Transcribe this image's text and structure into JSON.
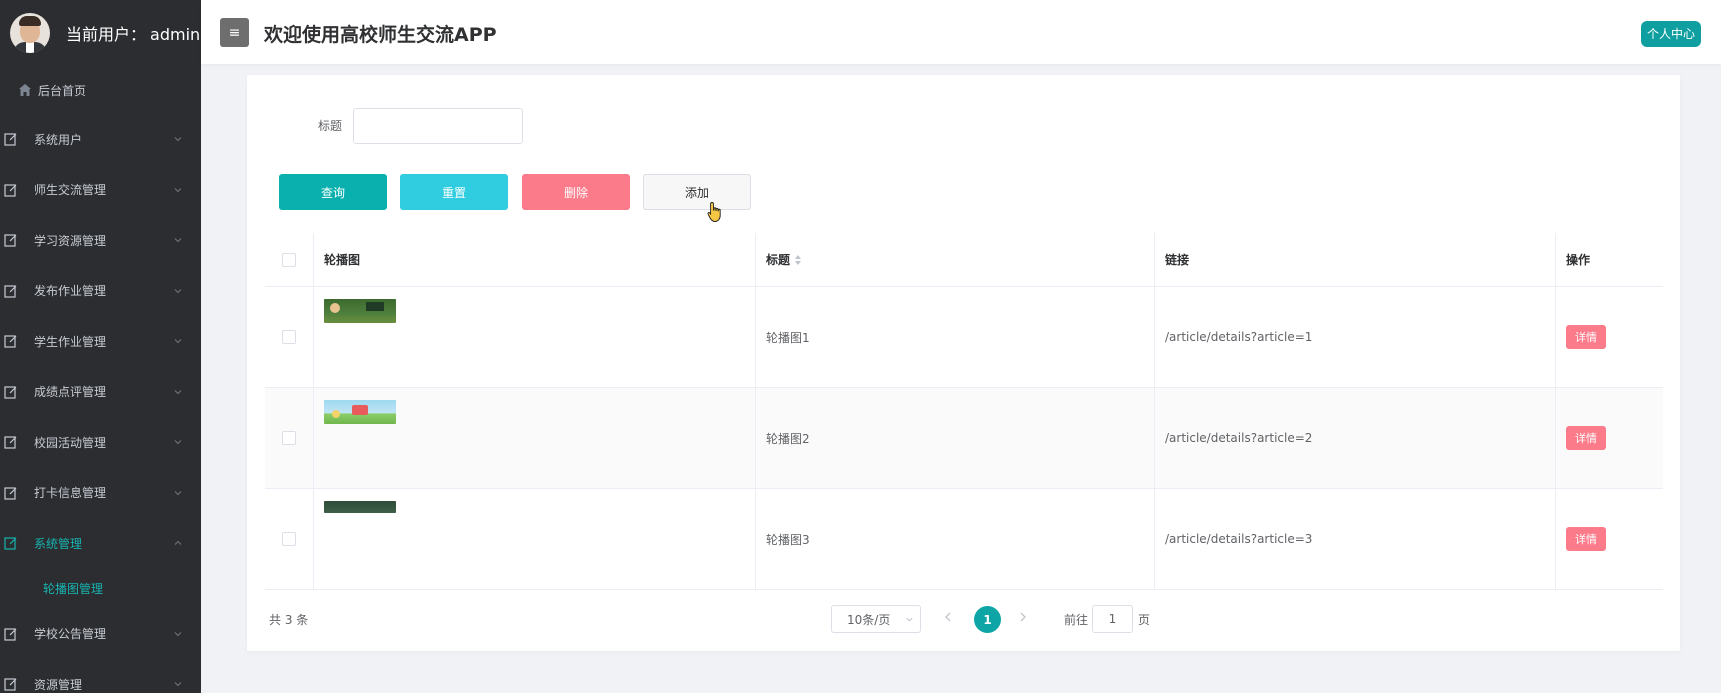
{
  "sidebar": {
    "user_prefix": "当前用户：",
    "user_name": "admin",
    "home_label": "后台首页",
    "items": [
      {
        "label": "系统用户"
      },
      {
        "label": "师生交流管理"
      },
      {
        "label": "学习资源管理"
      },
      {
        "label": "发布作业管理"
      },
      {
        "label": "学生作业管理"
      },
      {
        "label": "成绩点评管理"
      },
      {
        "label": "校园活动管理"
      },
      {
        "label": "打卡信息管理"
      },
      {
        "label": "系统管理"
      },
      {
        "label": "学校公告管理"
      },
      {
        "label": "资源管理"
      }
    ],
    "active_sub_label": "轮播图管理"
  },
  "header": {
    "menu_icon": "≡",
    "title": "欢迎使用高校师生交流APP",
    "profile_button": "个人中心"
  },
  "search": {
    "label": "标题",
    "value": "",
    "placeholder": ""
  },
  "toolbar": {
    "query_label": "查询",
    "reset_label": "重置",
    "delete_label": "删除",
    "add_label": "添加"
  },
  "table": {
    "headers": {
      "image": "轮播图",
      "title": "标题",
      "link": "链接",
      "actions": "操作"
    },
    "rows": [
      {
        "title": "轮播图1",
        "link": "/article/details?article=1",
        "action": "详情"
      },
      {
        "title": "轮播图2",
        "link": "/article/details?article=2",
        "action": "详情"
      },
      {
        "title": "轮播图3",
        "link": "/article/details?article=3",
        "action": "详情"
      }
    ]
  },
  "pagination": {
    "total_text": "共 3 条",
    "page_size": "10条/页",
    "current_page": "1",
    "goto_prefix": "前往",
    "goto_value": "1",
    "goto_suffix": "页"
  },
  "colors": {
    "sidebar_bg": "#2b2d30",
    "accent": "#0ab0ae",
    "reset": "#30cde0",
    "danger": "#fb7b8a"
  }
}
